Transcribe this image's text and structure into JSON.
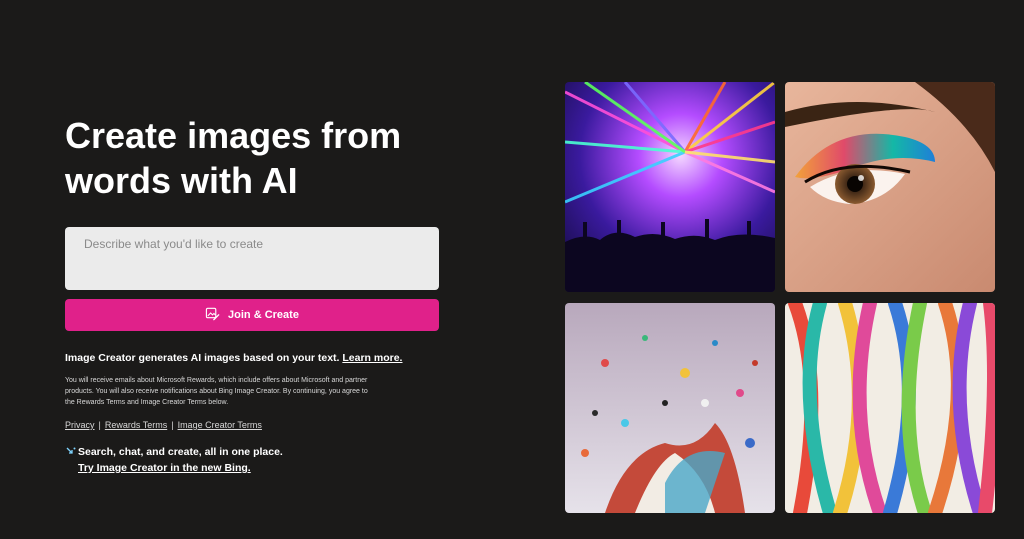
{
  "hero": {
    "title_line1": "Create images from",
    "title_line2": "words with AI"
  },
  "prompt": {
    "placeholder": "Describe what you'd like to create"
  },
  "join_button": {
    "label": "Join & Create",
    "icon": "image-edit-icon",
    "color": "#e0218a"
  },
  "info": {
    "text": "Image Creator generates AI images based on your text.",
    "link": "Learn more."
  },
  "fine_print": "You will receive emails about Microsoft Rewards, which include offers about Microsoft and partner products. You will also receive notifications about Bing Image Creator. By continuing, you agree to the Rewards Terms and Image Creator Terms below.",
  "footer_links": {
    "privacy": "Privacy",
    "separator": "|",
    "rewards_terms": "Rewards Terms",
    "image_creator_terms": "Image Creator Terms"
  },
  "promo": {
    "icon": "bing-chat-icon",
    "line1": "Search, chat, and create, all in one place.",
    "line2": "Try Image Creator in the new Bing."
  },
  "gallery": [
    {
      "subject": "concert-lasers-image"
    },
    {
      "subject": "colorful-eye-makeup-image"
    },
    {
      "subject": "paint-splash-image"
    },
    {
      "subject": "colorful-ribbons-image"
    }
  ],
  "colors": {
    "background": "#1b1a19",
    "accent": "#e0218a",
    "input_bg": "#ebebeb"
  }
}
